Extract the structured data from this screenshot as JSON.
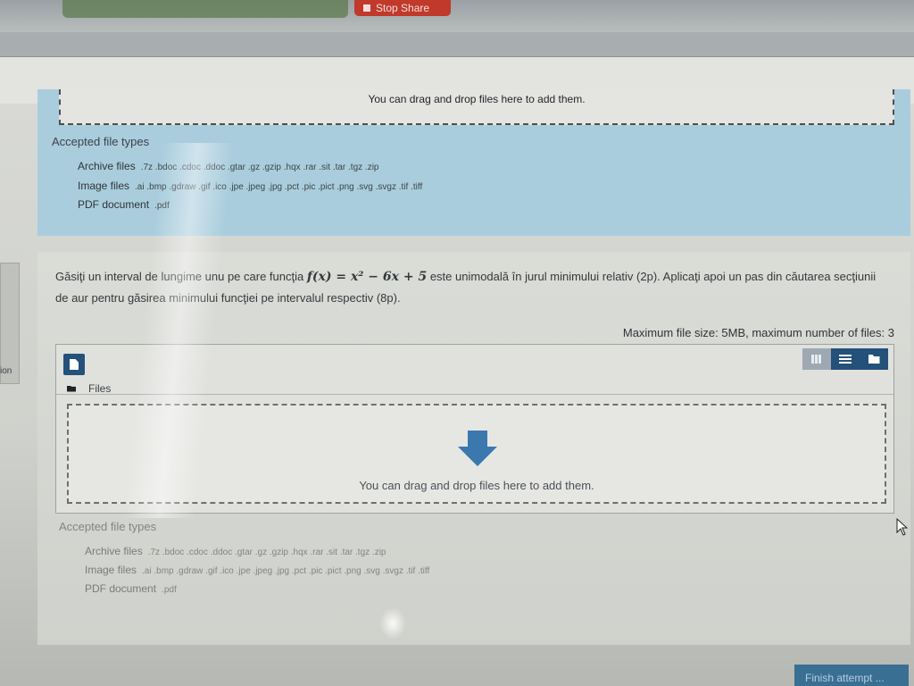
{
  "share_bar": {
    "stop_share_label": "Stop Share"
  },
  "upload_block_1": {
    "drop_text": "You can drag and drop files here to add them.",
    "accepted_title": "Accepted file types",
    "types": [
      {
        "label": "Archive files",
        "ext": ".7z .bdoc .cdoc .ddoc .gtar .gz .gzip .hqx .rar .sit .tar .tgz .zip"
      },
      {
        "label": "Image files",
        "ext": ".ai .bmp .gdraw .gif .ico .jpe .jpeg .jpg .pct .pic .pict .png .svg .svgz .tif .tiff"
      },
      {
        "label": "PDF document",
        "ext": ".pdf"
      }
    ]
  },
  "question": {
    "text_before": "Găsiţi un interval de lungime unu pe care funcţia ",
    "formula": "f(x) = x² − 6x + 5",
    "text_after": " este unimodală în jurul minimului relativ (2p). Aplicaţi apoi un pas din căutarea secţiunii de aur pentru găsirea minimului funcţiei pe intervalul respectiv (8p)."
  },
  "file_manager": {
    "limits": "Maximum file size: 5MB, maximum number of files: 3",
    "files_label": "Files",
    "drop_text": "You can drag and drop files here to add them."
  },
  "upload_block_2": {
    "accepted_title": "Accepted file types",
    "types": [
      {
        "label": "Archive files",
        "ext": ".7z .bdoc .cdoc .ddoc .gtar .gz .gzip .hqx .rar .sit .tar .tgz .zip"
      },
      {
        "label": "Image files",
        "ext": ".ai .bmp .gdraw .gif .ico .jpe .jpeg .jpg .pct .pic .pict .png .svg .svgz .tif .tiff"
      },
      {
        "label": "PDF document",
        "ext": ".pdf"
      }
    ]
  },
  "sidebar": {
    "partial_label": "ion"
  },
  "footer": {
    "finish_label": "Finish attempt ..."
  },
  "colors": {
    "question_bg": "#a9cddd",
    "accent": "#23517a",
    "stop_share": "#c0392b"
  }
}
